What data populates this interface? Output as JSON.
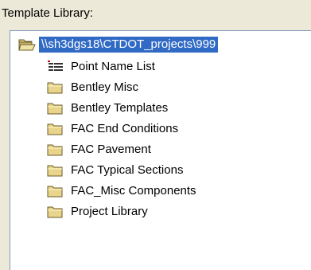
{
  "panel": {
    "title": "Template Library:"
  },
  "tree": {
    "root": {
      "label": "\\\\sh3dgs18\\CTDOT_projects\\999",
      "icon": "open-folder-icon",
      "selected": true
    },
    "items": [
      {
        "label": "Point Name List",
        "icon": "list-icon"
      },
      {
        "label": "Bentley Misc",
        "icon": "folder-icon"
      },
      {
        "label": "Bentley Templates",
        "icon": "folder-icon"
      },
      {
        "label": "FAC End Conditions",
        "icon": "folder-icon"
      },
      {
        "label": "FAC Pavement",
        "icon": "folder-icon"
      },
      {
        "label": "FAC Typical Sections",
        "icon": "folder-icon"
      },
      {
        "label": "FAC_Misc Components",
        "icon": "folder-icon"
      },
      {
        "label": "Project Library",
        "icon": "folder-icon"
      }
    ]
  },
  "colors": {
    "selection": "#316ac5",
    "folder": "#e8d48a",
    "background": "#ece9d8"
  }
}
